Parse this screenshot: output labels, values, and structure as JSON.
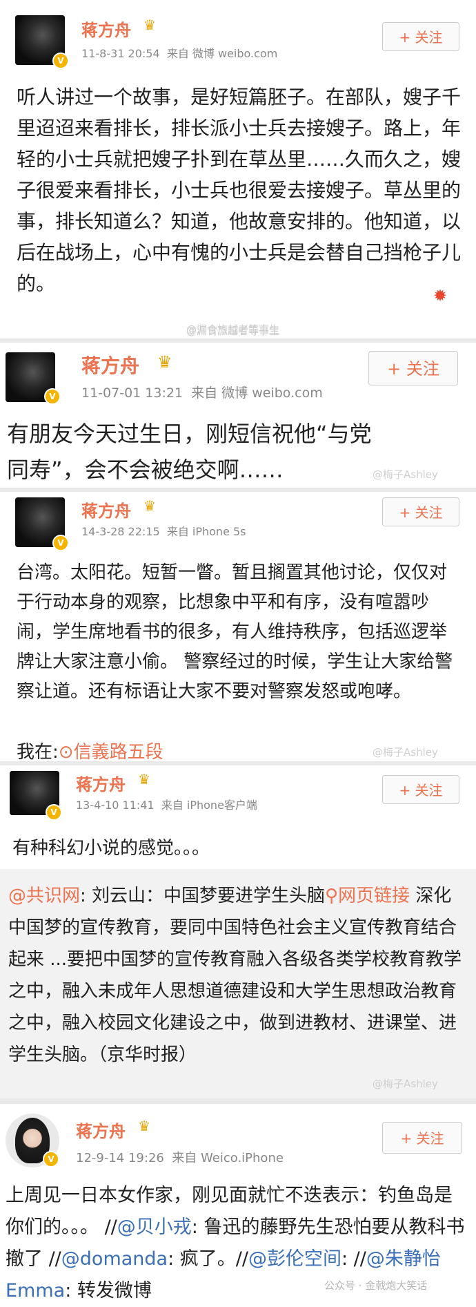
{
  "posts": [
    {
      "name": "蒋方舟",
      "time": "11-8-31 20:54",
      "source": "来自 微博 weibo.com",
      "follow": "+ 关注",
      "text": "听人讲过一个故事，是好短篇胚子。在部队，嫂子千里迢迢来看排长，排长派小士兵去接嫂子。路上，年轻的小士兵就把嫂子扑到在草丛里……久而久之，嫂子很爱来看排长，小士兵也很爱去接嫂子。草丛里的事，排长知道么？知道，他故意安排的。他知道，以后在战场上，心中有愧的小士兵是会替自己挡枪子儿的。",
      "watermark": "@漏食旅越者等事生"
    },
    {
      "name": "蒋方舟",
      "time": "11-07-01 13:21",
      "source": "来自 微博 weibo.com",
      "follow": "+ 关注",
      "text": "有朋友今天过生日，刚短信祝他“与党同寿”，会不会被绝交啊……",
      "watermark": "@梅子Ashley"
    },
    {
      "name": "蒋方舟",
      "time": "14-3-28 22:15",
      "source": "来自 iPhone 5s",
      "follow": "+ 关注",
      "text": "台湾。太阳花。短暂一瞥。暂且搁置其他讨论，仅仅对于行动本身的观察，比想象中平和有序，没有喧嚣吵闹，学生席地看书的很多，有人维持秩序，包括巡逻举牌让大家注意小偷。 警察经过的时候，学生让大家给警察让道。还有标语让大家不要对警察发怒或咆哮。",
      "location_prefix": "我在:",
      "location": "信義路五段",
      "watermark": "@梅子Ashley"
    },
    {
      "name": "蒋方舟",
      "time": "13-4-10 11:41",
      "source": "来自 iPhone客户端",
      "follow": "+ 关注",
      "text": "有种科幻小说的感觉。。。",
      "quote_at": "@共识网",
      "quote_body1": ": 刘云山：中国梦要进学生头脑",
      "quote_link": "网页链接",
      "quote_body2": " 深化中国梦的宣传教育，要同中国特色社会主义宣传教育结合起来 ...要把中国梦的宣传教育融入各级各类学校教育教学之中，融入未成年人思想道德建设和大学生思想政治教育之中，融入校园文化建设之中，做到进教材、进课堂、进学生头脑。（京华时报）",
      "watermark": "@梅子Ashley"
    },
    {
      "name": "蒋方舟",
      "time": "12-9-14 19:26",
      "source": "来自 Weico.iPhone",
      "follow": "+ 关注",
      "text_a": "上周见一日本女作家，刚见面就忙不迭表示：钓鱼岛是你们的。。。 //",
      "at1": "@贝小戎",
      "text_b": ": 鲁迅的藤野先生恐怕要从教科书撤了 //",
      "at2": "@domanda",
      "text_c": ": 疯了。//",
      "at3": "@彭伦空间",
      "text_d": ": //",
      "at4": "@朱静怡Emma",
      "text_e": ": 转发微博",
      "watermark": "公众号 · 金戟炮大笑话"
    }
  ]
}
